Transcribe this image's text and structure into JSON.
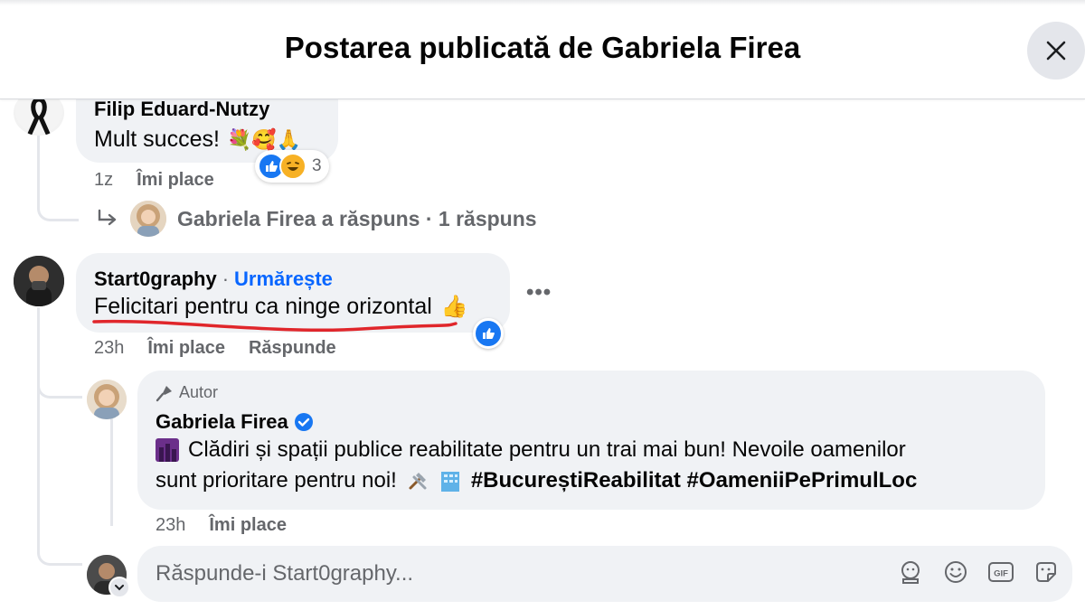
{
  "dialog": {
    "title": "Postarea publicată de Gabriela Firea"
  },
  "comment1": {
    "author": "Filip Eduard-Nutzy",
    "text": "Mult succes!",
    "emoji": "💐🥰🙏",
    "reaction_count": "3",
    "time": "1z",
    "like_label": "Îmi place"
  },
  "reply_summary": {
    "text": "Gabriela Firea a răspuns · 1 răspuns"
  },
  "comment2": {
    "author": "Start0graphy",
    "follow_label": "Urmărește",
    "text": "Felicitari pentru ca ninge orizontal",
    "emoji": "👍",
    "time": "23h",
    "like_label": "Îmi place",
    "reply_label": "Răspunde",
    "more_label": "•••"
  },
  "reply": {
    "badge": "Autor",
    "author": "Gabriela Firea",
    "text_line1": "Clădiri și spații publice reabilitate pentru un trai mai bun! Nevoile oamenilor",
    "text_line2": "sunt prioritare pentru noi!",
    "hashtags": "#BucureștiReabilitat #OameniiPePrimulLoc",
    "time": "23h",
    "like_label": "Îmi place"
  },
  "reply_box": {
    "placeholder": "Răspunde-i Start0graphy..."
  },
  "colors": {
    "accent": "#0866ff",
    "bubble": "#f0f2f5",
    "underline": "#e0262b"
  }
}
